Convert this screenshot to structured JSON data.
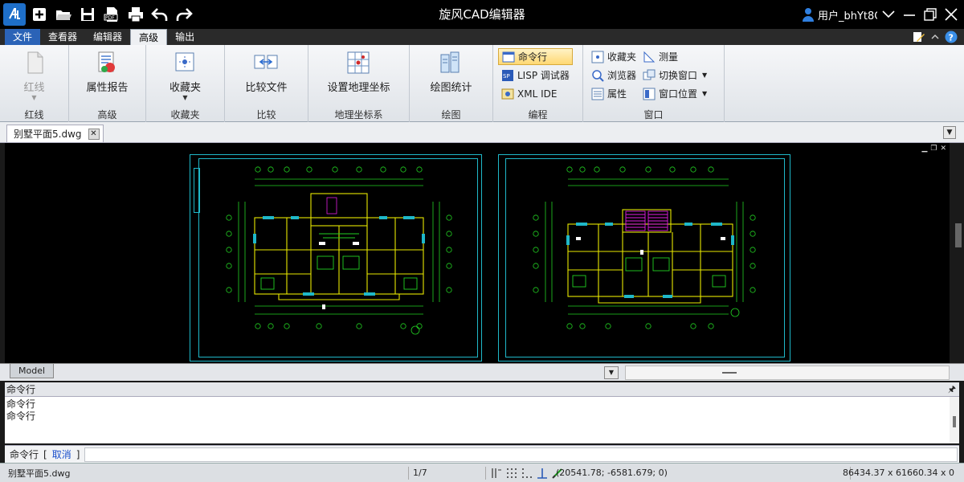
{
  "titlebar": {
    "title": "旋风CAD编辑器",
    "user": "用户_bhYt8O",
    "quick_access": [
      "app-logo",
      "new-file-icon",
      "open-folder-icon",
      "save-icon",
      "pdf-icon",
      "print-icon",
      "undo-icon",
      "redo-icon"
    ]
  },
  "ribbon_tabs": [
    {
      "label": "文件",
      "kind": "file"
    },
    {
      "label": "查看器",
      "kind": "normal"
    },
    {
      "label": "编辑器",
      "kind": "normal"
    },
    {
      "label": "高级",
      "kind": "active"
    },
    {
      "label": "输出",
      "kind": "normal"
    }
  ],
  "ribbon": {
    "groups": [
      {
        "label": "红线",
        "big": {
          "label": "红线",
          "disabled": true
        }
      },
      {
        "label": "高级",
        "big": {
          "label": "属性报告"
        }
      },
      {
        "label": "收藏夹",
        "big": {
          "label": "收藏夹"
        }
      },
      {
        "label": "比较",
        "big": {
          "label": "比较文件"
        }
      },
      {
        "label": "地理坐标系",
        "big": {
          "label": "设置地理坐标"
        }
      },
      {
        "label": "绘图",
        "big": {
          "label": "绘图统计"
        }
      },
      {
        "label": "编程",
        "smalls": [
          "命令行",
          "LISP 调试器",
          "XML IDE"
        ]
      },
      {
        "label": "窗口",
        "smalls_a": [
          "收藏夹",
          "浏览器",
          "属性"
        ],
        "smalls_b": [
          "测量",
          "切换窗口",
          "窗口位置"
        ]
      }
    ]
  },
  "document": {
    "tab_label": "别墅平面5.dwg"
  },
  "model_tab": "Model",
  "command": {
    "header": "命令行",
    "history": [
      "命令行",
      "命令行"
    ],
    "prompt": "命令行",
    "bracket_open": "[",
    "cancel": "取消",
    "bracket_close": "]"
  },
  "status": {
    "file": "别墅平面5.dwg",
    "page": "1/7",
    "coords": "(20541.78; -6581.679; 0)",
    "size": "86434.37 x 61660.34 x 0"
  },
  "colors": {
    "accent": "#2b63b7",
    "cad_cyan": "#1fb8c9",
    "cad_green": "#22d022",
    "cad_yellow": "#e8e800",
    "cad_magenta": "#e020e0"
  }
}
